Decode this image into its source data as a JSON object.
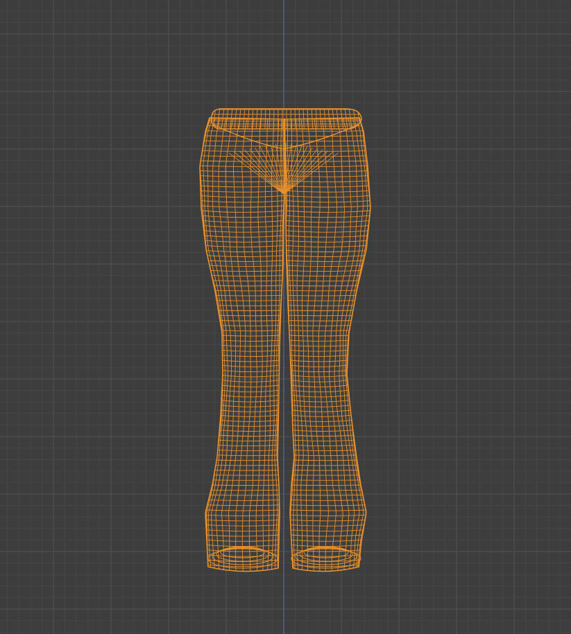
{
  "viewport": {
    "background_color": "#3d3d3d",
    "grid_color_minor": "#464646",
    "grid_color_major": "#4f4f4f",
    "axis_color": "#4a6d9c",
    "wire_color": "#e8912d",
    "view_mode": "wireframe",
    "object": "pants-mesh",
    "object_selected": true
  }
}
